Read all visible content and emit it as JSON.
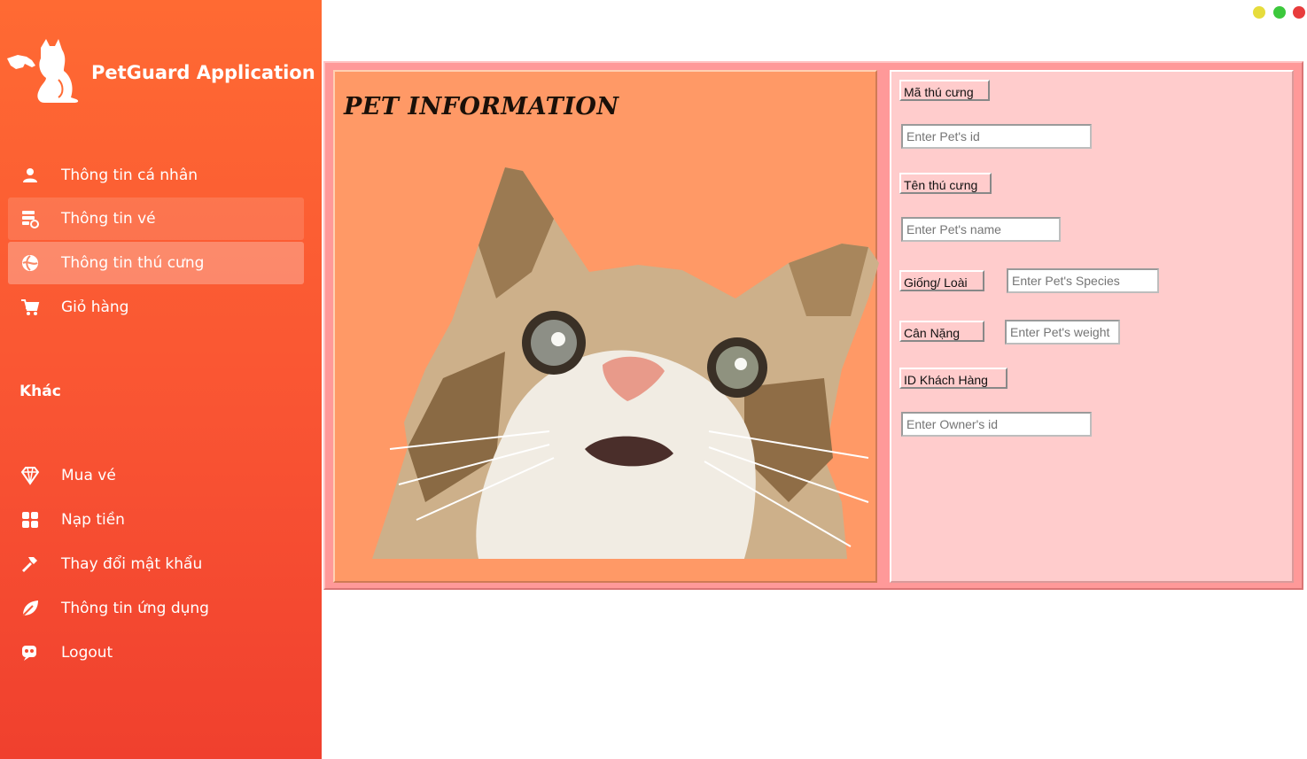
{
  "app": {
    "title": "PetGuard Application"
  },
  "sidebar": {
    "items": [
      {
        "label": "Thông tin cá nhân",
        "icon": "user-icon"
      },
      {
        "label": "Thông tin vé",
        "icon": "ticket-icon"
      },
      {
        "label": "Thông tin thú cưng",
        "icon": "pet-icon"
      },
      {
        "label": "Giỏ hàng",
        "icon": "cart-icon"
      }
    ],
    "section_title": "Khác",
    "other_items": [
      {
        "label": "Mua vé",
        "icon": "diamond-icon"
      },
      {
        "label": "Nạp tiền",
        "icon": "grid-icon"
      },
      {
        "label": "Thay đổi mật khẩu",
        "icon": "hammer-icon"
      },
      {
        "label": "Thông tin ứng dụng",
        "icon": "leaf-icon"
      },
      {
        "label": "Logout",
        "icon": "logout-icon"
      }
    ]
  },
  "window_controls": {
    "minimize_color": "#e6dc3c",
    "maximize_color": "#3cc83c",
    "close_color": "#e83c3c"
  },
  "main": {
    "heading": "PET INFORMATION",
    "fields": {
      "pet_id": {
        "label": "Mã thú cưng",
        "placeholder": "Enter Pet's id"
      },
      "pet_name": {
        "label": "Tên thú cưng",
        "placeholder": "Enter Pet's name"
      },
      "species": {
        "label": "Giống/ Loài",
        "placeholder": "Enter Pet's Species"
      },
      "weight": {
        "label": "Cân Nặng",
        "placeholder": "Enter Pet's weight"
      },
      "owner_id": {
        "label": "ID Khách Hàng",
        "placeholder": "Enter Owner's id"
      }
    }
  },
  "colors": {
    "sidebar_accent": "#ff6a33",
    "panel_outer": "#ff9999",
    "panel_left": "#ff9966",
    "panel_right": "#ffcccc"
  }
}
